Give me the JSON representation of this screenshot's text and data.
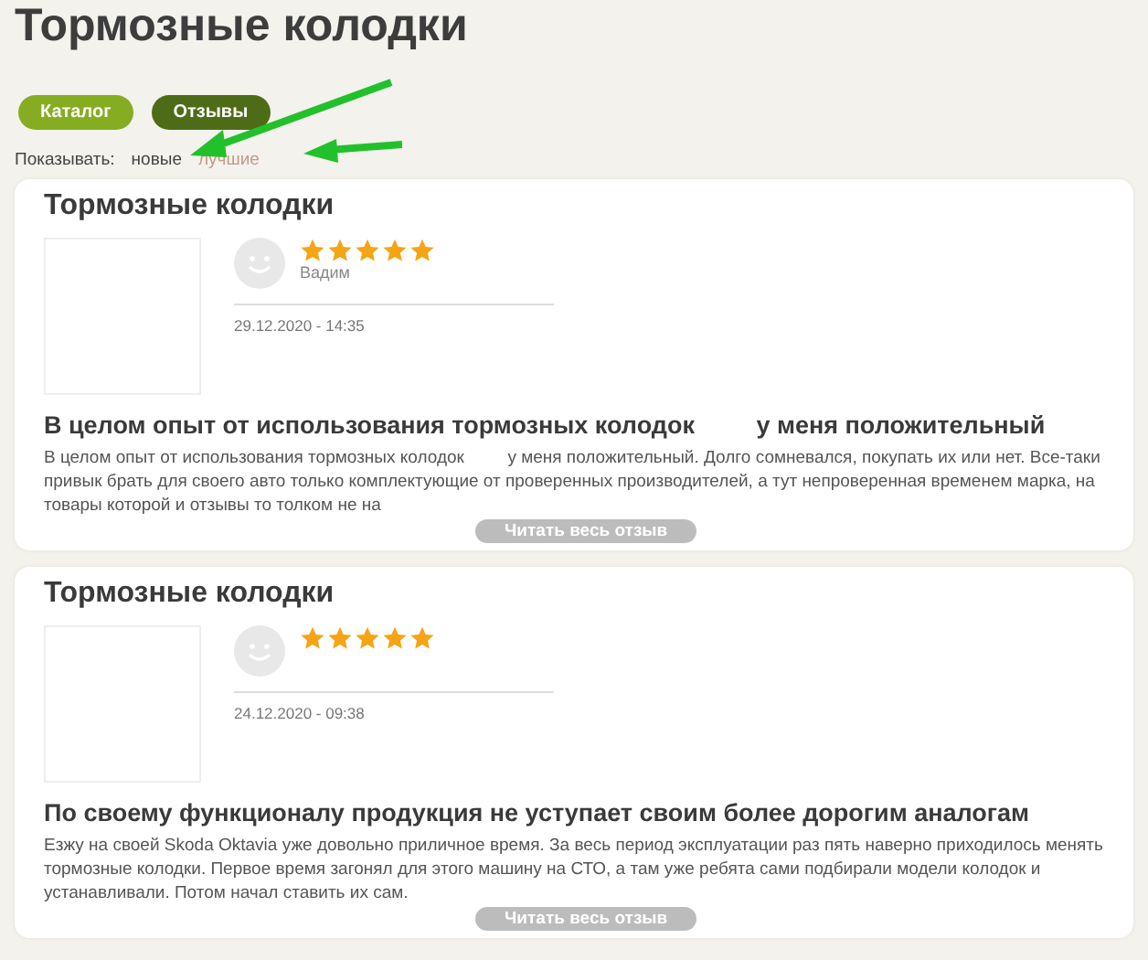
{
  "page_title": "Тормозные колодки",
  "tabs": [
    {
      "label": "Каталог",
      "selected": false
    },
    {
      "label": "Отзывы",
      "selected": true
    }
  ],
  "sort": {
    "label": "Показывать:",
    "options": [
      {
        "label": "новые",
        "selected": true
      },
      {
        "label": "лучшие",
        "selected": false
      }
    ]
  },
  "reviews": [
    {
      "product": "Тормозные колодки",
      "stars": 5,
      "author": "Вадим",
      "date": "29.12.2020 - 14:35",
      "title": "В целом опыт от использования тормозных колодок         у меня положительный",
      "body": "В целом опыт от использования тормозных колодок         у меня положительный. Долго сомневался, покупать их или нет. Все-таки привык брать для своего авто только комплектующие от проверенных производителей, а тут непроверенная временем марка, на товары которой и отзывы то толком не на",
      "read_more": "Читать весь отзыв"
    },
    {
      "product": "Тормозные колодки",
      "stars": 5,
      "date": "24.12.2020 - 09:38",
      "title": "По своему функционалу продукция не уступает своим более дорогим аналогам",
      "body": "Езжу на своей Skoda Oktavia уже довольно приличное время. За весь период эксплуатации раз пять наверно приходилось менять тормозные колодки. Первое время загонял для этого машину на СТО, а там уже ребята сами подбирали модели колодок и устанавливали. Потом начал ставить их сам.",
      "read_more": "Читать весь отзыв"
    }
  ]
}
